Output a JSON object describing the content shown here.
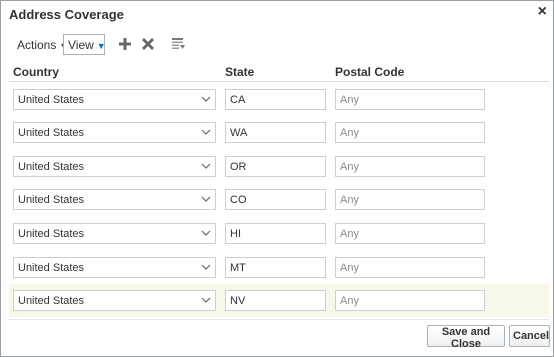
{
  "dialog": {
    "title": "Address Coverage",
    "close_label": "×"
  },
  "toolbar": {
    "actions_label": "Actions",
    "view_label": "View",
    "icons": [
      "add-icon",
      "delete-icon",
      "freeze-icon"
    ]
  },
  "table": {
    "columns": [
      "Country",
      "State",
      "Postal Code"
    ],
    "rows": [
      {
        "country": "United States",
        "state": "CA",
        "postal": "Any"
      },
      {
        "country": "United States",
        "state": "WA",
        "postal": "Any"
      },
      {
        "country": "United States",
        "state": "OR",
        "postal": "Any"
      },
      {
        "country": "United States",
        "state": "CO",
        "postal": "Any"
      },
      {
        "country": "United States",
        "state": "HI",
        "postal": "Any"
      },
      {
        "country": "United States",
        "state": "MT",
        "postal": "Any"
      },
      {
        "country": "United States",
        "state": "NV",
        "postal": "Any"
      }
    ]
  },
  "buttons": {
    "save_close_label": "Save and Close",
    "cancel_label": "Cancel"
  },
  "colors": {
    "selected_row": "#f7f8e9",
    "view_caret": "#0d6fc0",
    "icon_gray": "#666666"
  }
}
